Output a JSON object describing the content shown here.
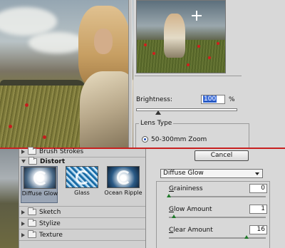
{
  "preview": {
    "brightness_label": "Brightness:",
    "brightness_value": "100",
    "brightness_unit": "%",
    "brightness_level": 0.22,
    "lens_type_label": "Lens Type",
    "lens_option": "50-300mm Zoom"
  },
  "gallery": {
    "categories_top": [
      "Brush Strokes"
    ],
    "open_category": "Distort",
    "thumbnails": [
      {
        "label": "Diffuse Glow",
        "selected": true
      },
      {
        "label": "Glass",
        "selected": false
      },
      {
        "label": "Ocean Ripple",
        "selected": false
      }
    ],
    "categories_bottom": [
      "Sketch",
      "Stylize",
      "Texture"
    ]
  },
  "panel": {
    "cancel_label": "Cancel",
    "filter_selected": "Diffuse Glow",
    "params": [
      {
        "label_pre": "",
        "label_u": "G",
        "label_post": "raininess",
        "value": "0",
        "level": 0.0
      },
      {
        "label_pre": "",
        "label_u": "G",
        "label_post": "low Amount",
        "value": "1",
        "level": 0.05
      },
      {
        "label_pre": "",
        "label_u": "C",
        "label_post": "lear Amount",
        "value": "16",
        "level": 0.8
      }
    ]
  }
}
